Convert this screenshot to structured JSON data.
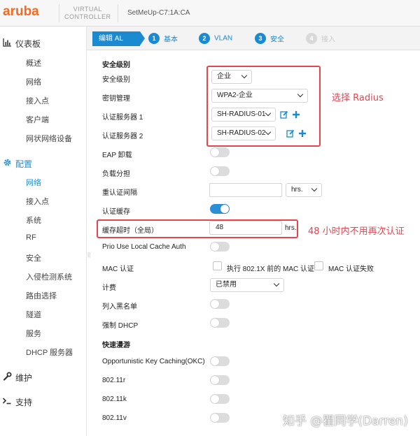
{
  "header": {
    "logo": "aruba",
    "product_line1": "VIRTUAL",
    "product_line2": "CONTROLLER",
    "device_name": "SetMeUp-C7:1A:CA"
  },
  "sidebar": {
    "dashboard": {
      "label": "仪表板",
      "items": [
        "概述",
        "网络",
        "接入点",
        "客户端",
        "网状网络设备"
      ]
    },
    "config": {
      "label": "配置",
      "items": [
        "网络",
        "接入点",
        "系统",
        "RF",
        "安全",
        "入侵检测系统",
        "路由选择",
        "隧道",
        "服务",
        "DHCP 服务器"
      ]
    },
    "maintain": {
      "label": "维护"
    },
    "support": {
      "label": "支持"
    }
  },
  "steps": {
    "edit": "编辑 AL",
    "list": [
      {
        "num": "1",
        "label": "基本",
        "enabled": true
      },
      {
        "num": "2",
        "label": "VLAN",
        "enabled": true
      },
      {
        "num": "3",
        "label": "安全",
        "enabled": true
      },
      {
        "num": "4",
        "label": "接入",
        "enabled": false
      }
    ]
  },
  "form": {
    "section_security": "安全级别",
    "security_level": {
      "label": "安全级别",
      "value": "企业"
    },
    "key_mgmt": {
      "label": "密钥管理",
      "value": "WPA2-企业"
    },
    "auth_server_1": {
      "label": "认证服务器 1",
      "value": "SH-RADIUS-01"
    },
    "auth_server_2": {
      "label": "认证服务器 2",
      "value": "SH-RADIUS-02"
    },
    "eap_offload": {
      "label": "EAP 卸载",
      "on": false
    },
    "load_balance": {
      "label": "负载分担",
      "on": false
    },
    "reauth_interval": {
      "label": "重认证间隔",
      "value": "",
      "unit": "hrs."
    },
    "auth_cache": {
      "label": "认证缓存",
      "on": true
    },
    "cache_timeout": {
      "label": "缓存超时（全局）",
      "value": "48",
      "unit": "hrs."
    },
    "prio_local_cache": {
      "label": "Prio Use Local Cache Auth",
      "on": false
    },
    "mac_auth": {
      "label": "MAC 认证",
      "opt1": "执行 802.1X 前的 MAC 认证",
      "opt2": "MAC 认证失败"
    },
    "accounting": {
      "label": "计费",
      "value": "已禁用"
    },
    "blacklist": {
      "label": "列入黑名单",
      "on": false
    },
    "force_dhcp": {
      "label": "强制 DHCP",
      "on": false
    },
    "section_roaming": "快速漫游",
    "okc": {
      "label": "Opportunistic Key Caching(OKC)",
      "on": false
    },
    "r80211r": {
      "label": "802.11r",
      "on": false
    },
    "r80211k": {
      "label": "802.11k",
      "on": false
    },
    "r80211v": {
      "label": "802.11v",
      "on": false
    }
  },
  "annotations": {
    "note1": "选择 Radius",
    "note2": "48 小时内不用再次认证"
  },
  "watermark": "知乎 @瞿同学(Darren)",
  "colors": {
    "brand": "#f26b21",
    "accent": "#1b8ad0",
    "annotation": "#e5454f"
  }
}
